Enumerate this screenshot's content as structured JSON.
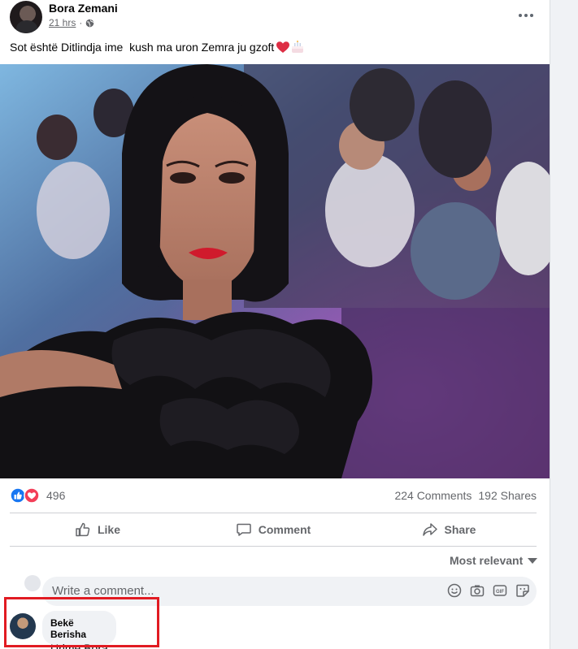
{
  "post": {
    "author": "Bora Zemani",
    "time": "21 hrs",
    "privacy_icon": "globe-icon",
    "text": "Sot është Ditlindja ime  kush ma uron Zemra ju gzoft",
    "emojis": [
      "red-heart-emoji",
      "birthday-cake-emoji"
    ]
  },
  "stats": {
    "reaction_icons": [
      "like-reaction-icon",
      "love-reaction-icon"
    ],
    "reactions": "496",
    "comments": "224 Comments",
    "shares": "192 Shares"
  },
  "actions": {
    "like": "Like",
    "comment": "Comment",
    "share": "Share"
  },
  "comments_section": {
    "sort_label": "Most relevant",
    "input_placeholder": "Write a comment...",
    "tools": [
      "emoji-icon",
      "camera-icon",
      "gif-icon",
      "sticker-icon"
    ]
  },
  "comments": [
    {
      "author": "Bekë Berisha",
      "text": "Urime Bora"
    }
  ],
  "colors": {
    "accent": "#1877f2",
    "love": "#f33e58",
    "highlight": "#e11b22",
    "secondary_text": "#65676b"
  }
}
